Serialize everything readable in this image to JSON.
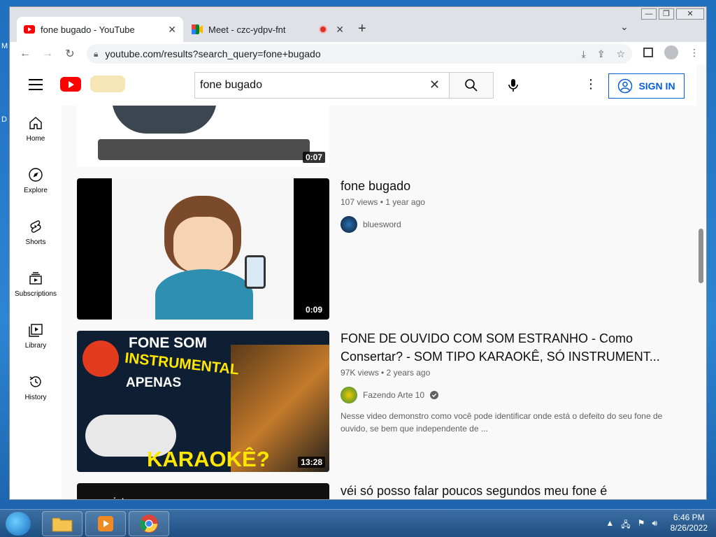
{
  "desktop": {
    "label_m": "M",
    "label_d": "D"
  },
  "browser": {
    "tabs": [
      {
        "title": "fone bugado - YouTube",
        "active": true,
        "close": "✕"
      },
      {
        "title": "Meet - czc-ydpv-fnt",
        "active": false,
        "close": "✕"
      }
    ],
    "new_tab_label": "+",
    "tab_list_label": "⌄",
    "url": "youtube.com/results?search_query=fone+bugado",
    "window_controls": [
      "—",
      "❐",
      "✕"
    ]
  },
  "youtube": {
    "search_value": "fone bugado",
    "signin_label": "SIGN IN",
    "nav": [
      {
        "label": "Home",
        "icon": "home-icon"
      },
      {
        "label": "Explore",
        "icon": "compass-icon"
      },
      {
        "label": "Shorts",
        "icon": "shorts-icon"
      },
      {
        "label": "Subscriptions",
        "icon": "subscriptions-icon"
      },
      {
        "label": "Library",
        "icon": "library-icon"
      },
      {
        "label": "History",
        "icon": "history-icon"
      }
    ],
    "results": [
      {
        "duration": "0:07"
      },
      {
        "title": "fone bugado",
        "meta": "107 views • 1 year ago",
        "channel": "bluesword",
        "duration": "0:09"
      },
      {
        "title_line1": "FONE DE OUVIDO COM SOM ESTRANHO - Como",
        "title_line2": "Consertar? - SOM TIPO KARAOKÊ, SÓ INSTRUMENT...",
        "meta": "97K views • 2 years ago",
        "channel": "Fazendo Arte 10",
        "desc_line1": "Nesse video demonstro como você pode identificar onde está o defeito do seu fone de",
        "desc_line2": "ouvido, se bem que independente de ...",
        "duration": "13:28",
        "thumb_text": {
          "top": "FONE SOM",
          "mid": "INSTRUMENTAL",
          "bot": "APENAS",
          "big": "KARAOKÊ?"
        }
      },
      {
        "title": "véi só posso falar poucos segundos meu fone é",
        "thumb_text": {
          "channel": "integra"
        }
      }
    ]
  },
  "taskbar": {
    "time": "6:46 PM",
    "date": "8/26/2022"
  }
}
